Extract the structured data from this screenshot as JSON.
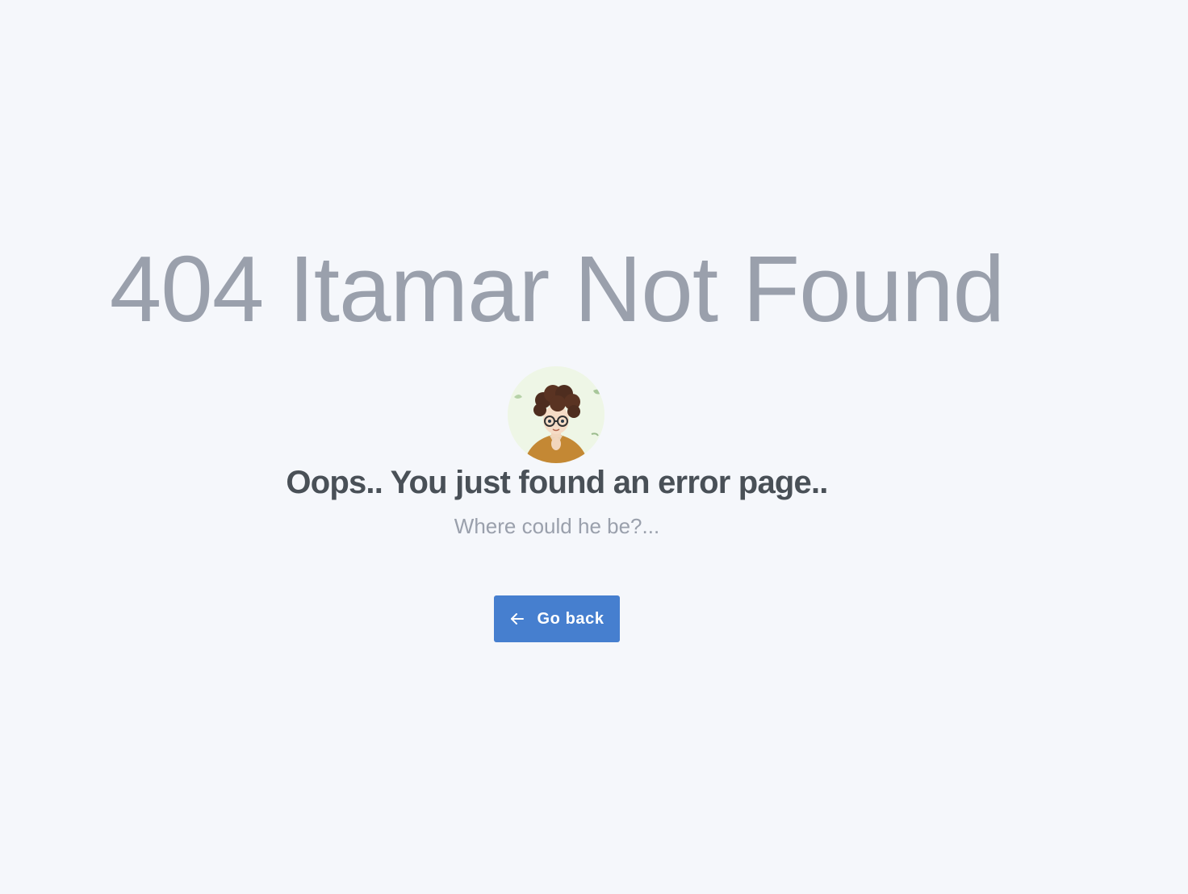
{
  "error": {
    "title": "404 Itamar Not Found",
    "heading": "Oops.. You just found an error page..",
    "subtitle": "Where could he be?...",
    "avatar_icon": "avatar-illustration",
    "back_button": {
      "label": "Go back",
      "icon": "arrow-left-icon"
    }
  },
  "colors": {
    "background": "#f5f7fb",
    "title": "#9aa0ac",
    "heading": "#495057",
    "subtitle": "#9aa0ac",
    "button": "#467fcf",
    "button_text": "#ffffff"
  }
}
